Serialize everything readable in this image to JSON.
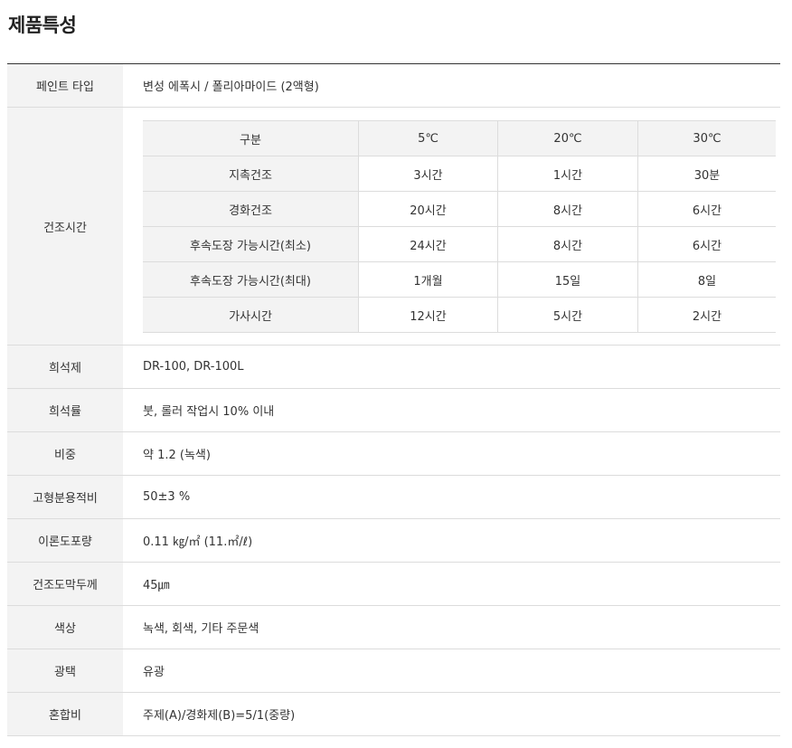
{
  "title": "제품특성",
  "rows": {
    "paint_type": {
      "label": "페인트 타입",
      "value": "변성 에폭시 / 폴리아마이드 (2액형)"
    },
    "drying_time": {
      "label": "건조시간"
    },
    "thinner": {
      "label": "희석제",
      "value": "DR-100, DR-100L"
    },
    "thinning_rate": {
      "label": "희석률",
      "value": "붓, 롤러 작업시 10% 이내"
    },
    "specific_gravity": {
      "label": "비중",
      "value": "약 1.2 (녹색)"
    },
    "solids_volume": {
      "label": "고형분용적비",
      "value": "50±3 %"
    },
    "coverage": {
      "label": "이론도포량",
      "value": "0.11 ㎏/㎡ (11.㎡/ℓ)"
    },
    "film_thickness": {
      "label": "건조도막두께",
      "value": "45㎛"
    },
    "color": {
      "label": "색상",
      "value": "녹색, 회색, 기타 주문색"
    },
    "gloss": {
      "label": "광택",
      "value": "유광"
    },
    "mix_ratio": {
      "label": "혼합비",
      "value": "주제(A)/경화제(B)=5/1(중량)"
    }
  },
  "drying_table": {
    "header": [
      "구분",
      "5℃",
      "20℃",
      "30℃"
    ],
    "rows": [
      [
        "지촉건조",
        "3시간",
        "1시간",
        "30분"
      ],
      [
        "경화건조",
        "20시간",
        "8시간",
        "6시간"
      ],
      [
        "후속도장 가능시간(최소)",
        "24시간",
        "8시간",
        "6시간"
      ],
      [
        "후속도장 가능시간(최대)",
        "1개월",
        "15일",
        "8일"
      ],
      [
        "가사시간",
        "12시간",
        "5시간",
        "2시간"
      ]
    ]
  }
}
